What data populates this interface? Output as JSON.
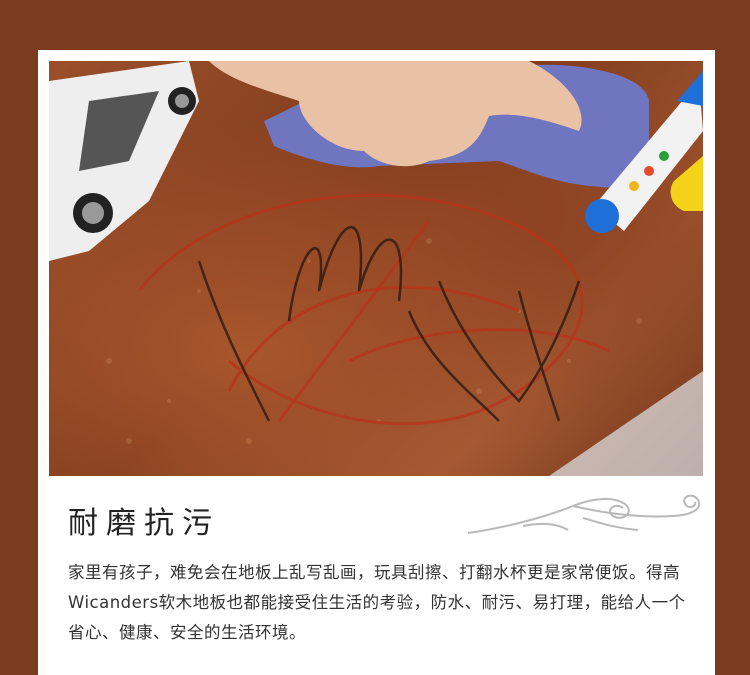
{
  "section": {
    "title": "耐磨抗污",
    "description": "家里有孩子，难免会在地板上乱写乱画，玩具刮擦、打翻水杯更是家常便饭。得高Wicanders软木地板也都能接受住生活的考验，防水、耐污、易打理，能给人一个省心、健康、安全的生活环境。"
  },
  "colors": {
    "frame": "#7a3b1f",
    "card": "#ffffff",
    "floor": "#9b4f2a"
  }
}
